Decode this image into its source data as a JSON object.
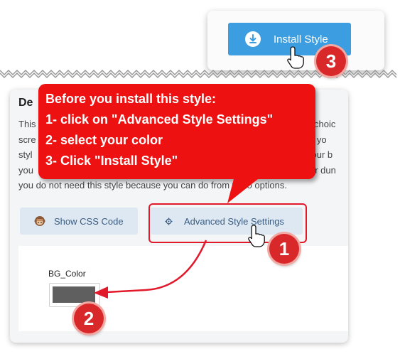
{
  "top": {
    "install_label": "Install Style"
  },
  "main": {
    "title": "De",
    "description_lines": [
      "This",
      "scre",
      "styl",
      "you",
      "you do not need this style because you can do      from trello options."
    ],
    "right_fragments": [
      "choic",
      "le if yo",
      "your b",
      "ur dun"
    ],
    "show_css_label": "Show CSS Code",
    "advanced_label": "Advanced Style Settings",
    "bg_color_label": "BG_Color",
    "bg_color_value": "#5f5f5f"
  },
  "callout": {
    "lines": [
      "Before you install this style:",
      "1- click on \"Advanced Style Settings\"",
      "2- select your color",
      "3- Click \"Install Style\""
    ]
  },
  "steps": [
    "1",
    "2",
    "3"
  ],
  "colors": {
    "accent": "#3c9ee0",
    "callout": "#ee1111",
    "badge": "#d9282a"
  },
  "icons": [
    "download-icon",
    "monkey-icon",
    "gear-icon",
    "hand-cursor-icon"
  ]
}
